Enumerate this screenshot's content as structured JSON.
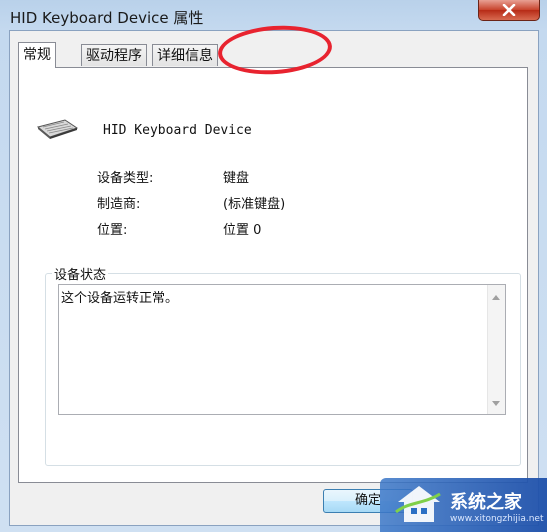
{
  "window": {
    "title": "HID Keyboard Device 属性",
    "close_label": "✕"
  },
  "tabs": [
    {
      "label": "常规",
      "active": true
    },
    {
      "label": "驱动程序",
      "active": false
    },
    {
      "label": "详细信息",
      "active": false
    }
  ],
  "device": {
    "name": "HID Keyboard Device",
    "icon": "keyboard-icon"
  },
  "properties": [
    {
      "label": "设备类型:",
      "value": "键盘"
    },
    {
      "label": "制造商:",
      "value": "(标准键盘)"
    },
    {
      "label": "位置:",
      "value": "位置 0"
    }
  ],
  "status_group": {
    "legend": "设备状态",
    "text": "这个设备运转正常。"
  },
  "buttons": {
    "ok": "确定"
  },
  "watermark": {
    "title": "系统之家",
    "url": "www.xitongzhijia.net"
  },
  "colors": {
    "annotation": "#e8232f",
    "title_bar": "#b9d1ea",
    "close_button": "#c7422b"
  }
}
